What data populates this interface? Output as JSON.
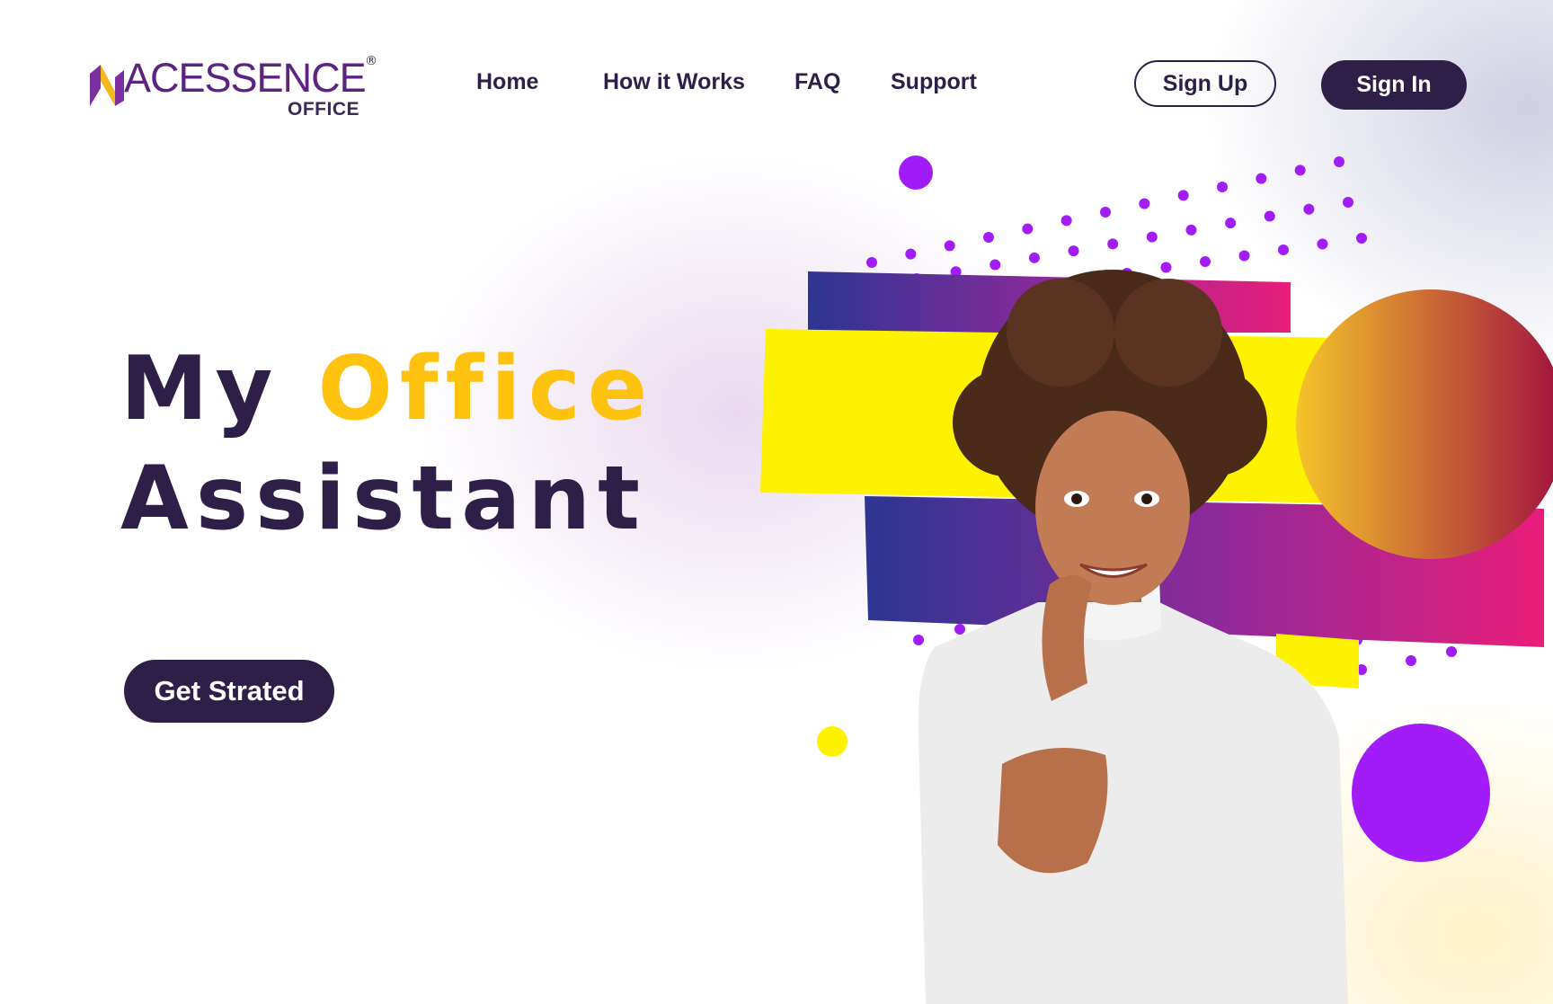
{
  "header": {
    "logo": {
      "name": "ACESSENCE",
      "registered": "®",
      "sub": "OFFICE"
    },
    "nav": [
      {
        "label": "Home"
      },
      {
        "label": "How it Works"
      },
      {
        "label": "FAQ"
      },
      {
        "label": "Support"
      }
    ],
    "signup_label": "Sign Up",
    "signin_label": "Sign In"
  },
  "hero": {
    "title_word1": "My",
    "title_accent": "Office",
    "title_line2": "Assistant",
    "cta_label": "Get Strated"
  },
  "colors": {
    "primary": "#2d1f47",
    "accent_yellow": "#ffc30f",
    "purple": "#a21cf8",
    "magenta": "#e91e7a",
    "indigo": "#2d3592",
    "bright_yellow": "#fff200"
  },
  "illustration": {
    "subject": "smiling-woman-photo"
  }
}
